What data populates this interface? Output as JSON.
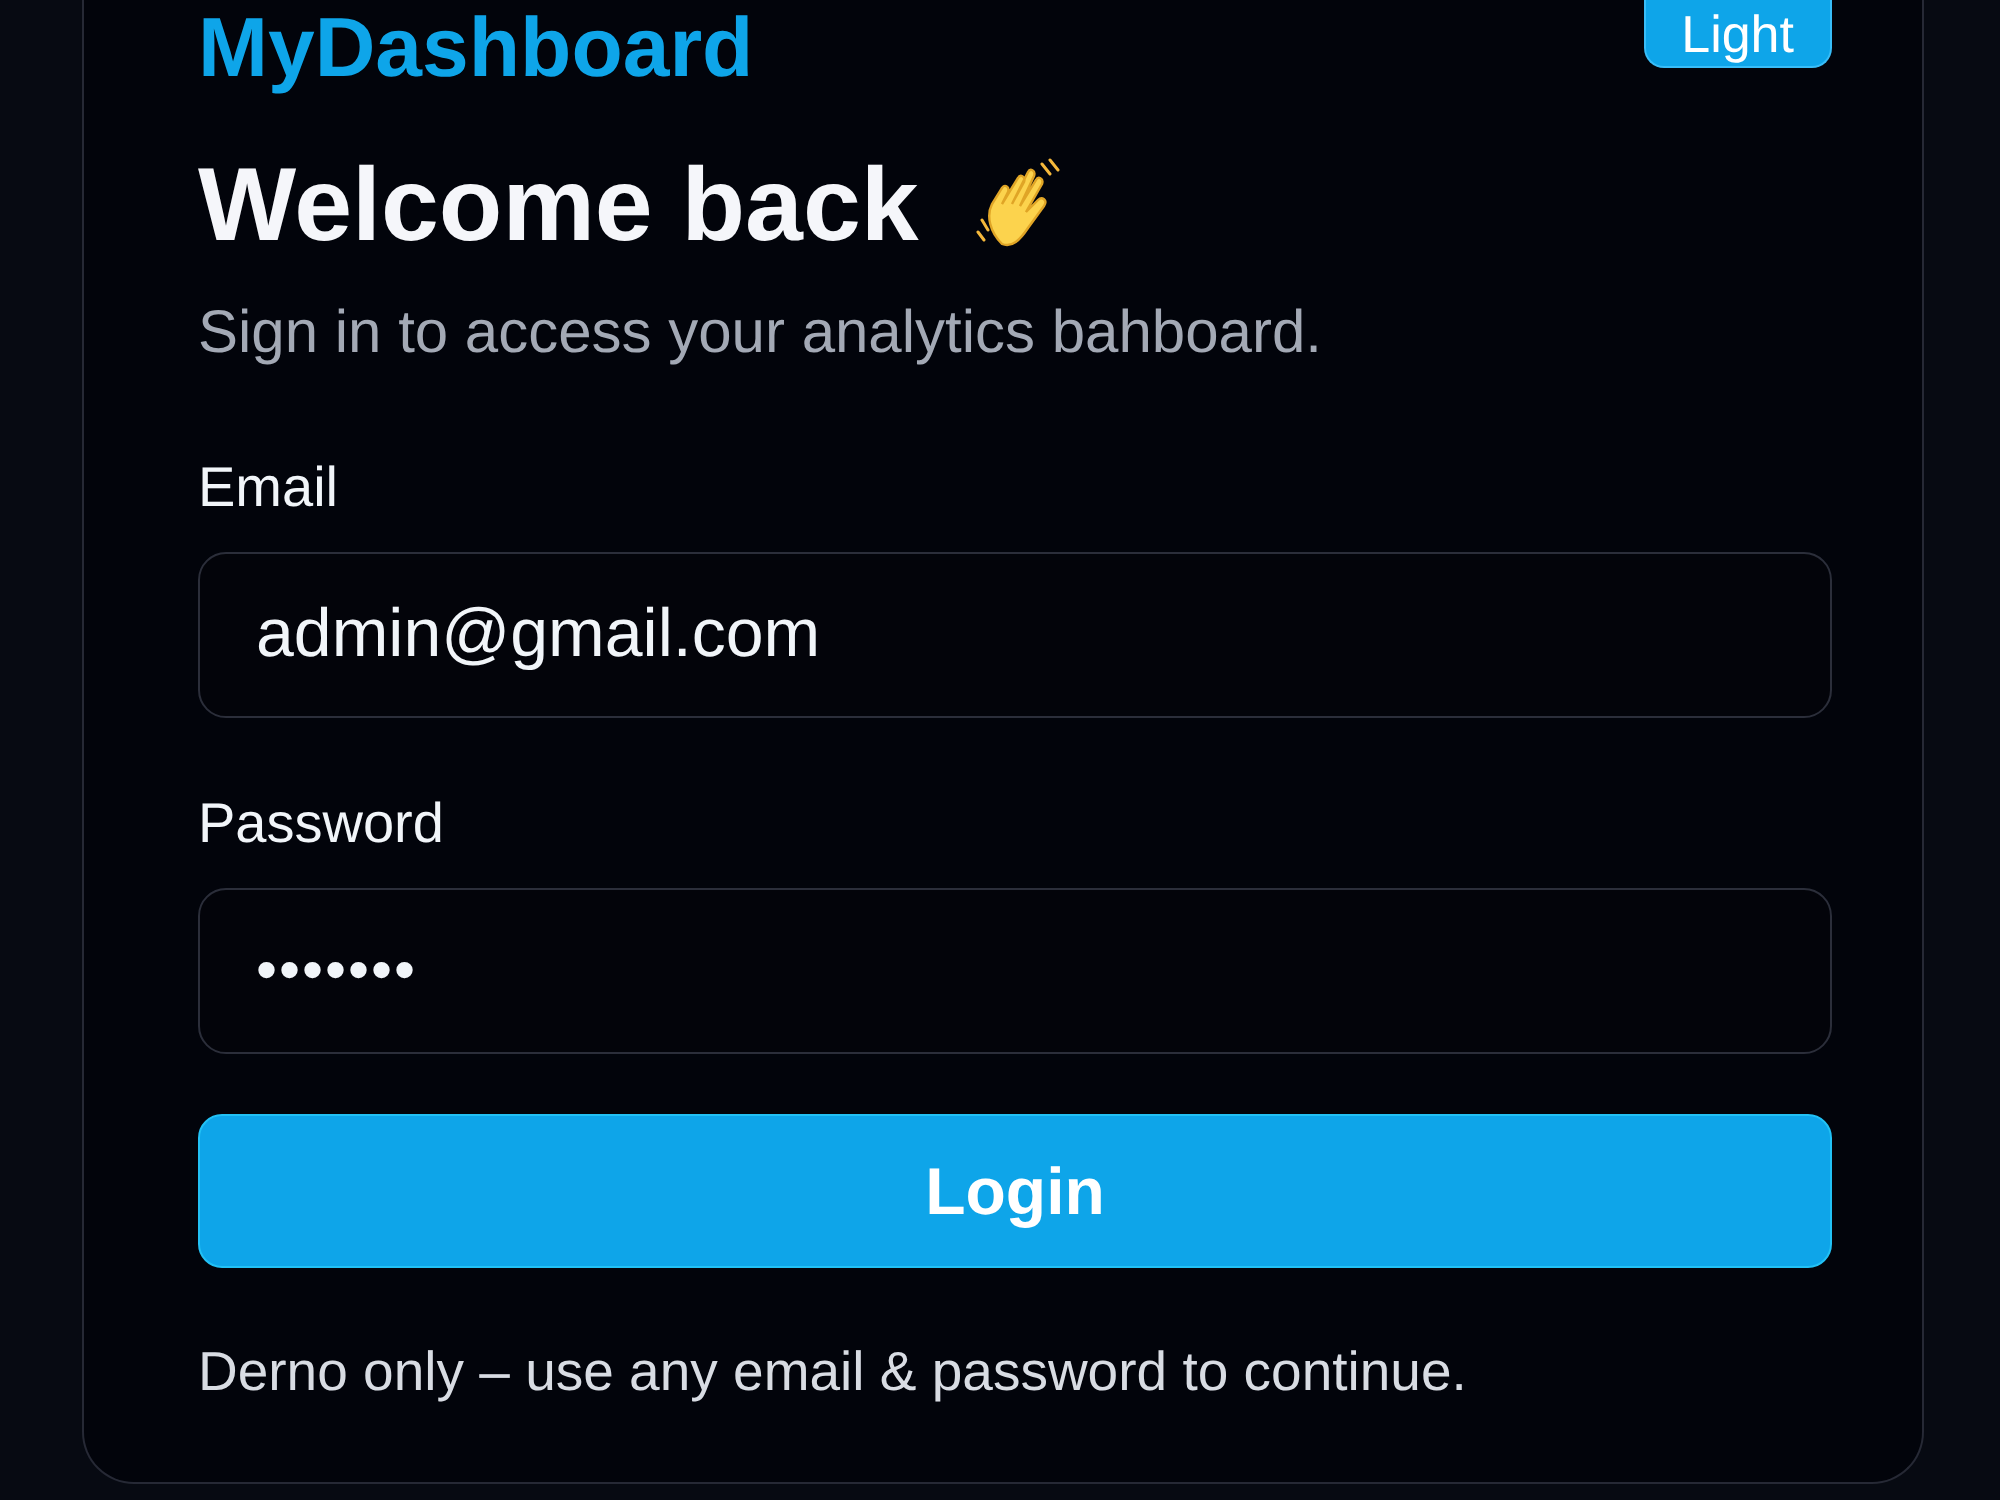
{
  "header": {
    "brand": "MyDashboard",
    "theme_button": "Light"
  },
  "heading": "Welcome back",
  "subtitle": "Sign in to access your analytics bahboard.",
  "fields": [
    {
      "kind": "email",
      "label": "Email",
      "value": "admin@gmail.com"
    },
    {
      "kind": "password",
      "label": "Password",
      "value": "•••••••"
    }
  ],
  "submit_button": "Login",
  "note": "Derno only – use any email & password to continue."
}
